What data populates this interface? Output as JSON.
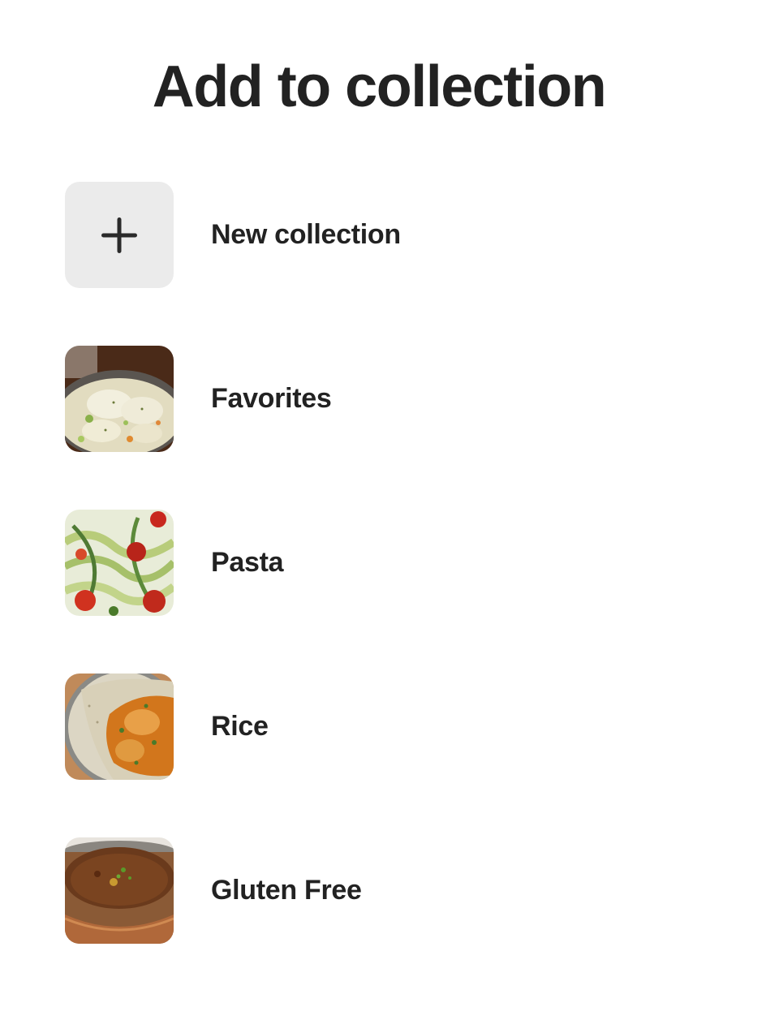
{
  "title": "Add to collection",
  "new_collection": {
    "label": "New collection",
    "icon": "plus-icon"
  },
  "collections": [
    {
      "label": "Favorites",
      "thumb": "creamy-dumpling-stew"
    },
    {
      "label": "Pasta",
      "thumb": "zucchini-noodles-tomatoes"
    },
    {
      "label": "Rice",
      "thumb": "curry-with-rice"
    },
    {
      "label": "Gluten Free",
      "thumb": "lentil-soup-copper-pot"
    }
  ]
}
